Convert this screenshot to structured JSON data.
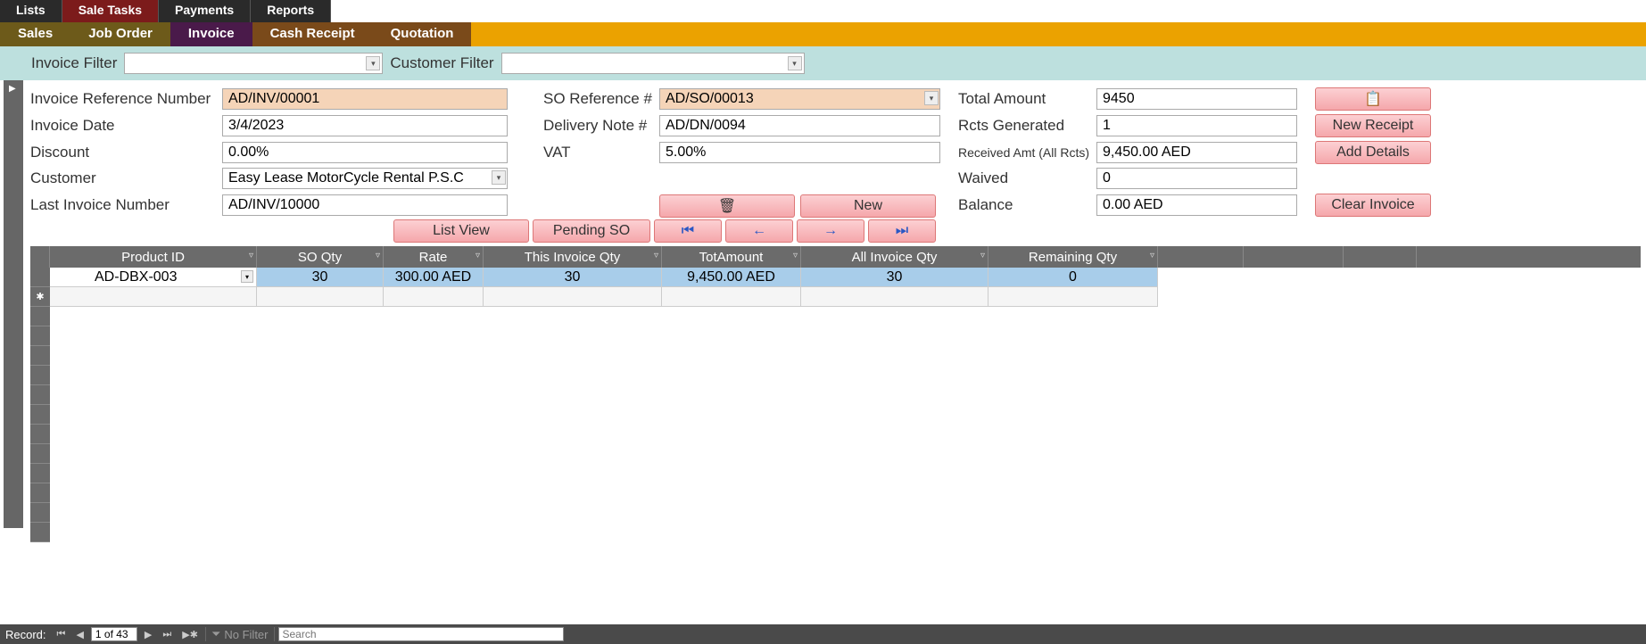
{
  "topTabs": {
    "lists": "Lists",
    "saleTasks": "Sale Tasks",
    "payments": "Payments",
    "reports": "Reports"
  },
  "subTabs": {
    "sales": "Sales",
    "jobOrder": "Job Order",
    "invoice": "Invoice",
    "cashReceipt": "Cash Receipt",
    "quotation": "Quotation"
  },
  "filters": {
    "invoiceFilterLabel": "Invoice Filter",
    "customerFilterLabel": "Customer Filter",
    "invoiceFilterValue": "",
    "customerFilterValue": ""
  },
  "form": {
    "invRefLbl": "Invoice Reference Number",
    "invRef": "AD/INV/00001",
    "invDateLbl": "Invoice Date",
    "invDate": "3/4/2023",
    "discountLbl": "Discount",
    "discount": "0.00%",
    "customerLbl": "Customer",
    "customer": "Easy Lease MotorCycle Rental P.S.C",
    "lastInvLbl": "Last Invoice Number",
    "lastInv": "AD/INV/10000",
    "soRefLbl": "SO Reference #",
    "soRef": "AD/SO/00013",
    "delNoteLbl": "Delivery Note #",
    "delNote": "AD/DN/0094",
    "vatLbl": "VAT",
    "vat": "5.00%",
    "totAmtLbl": "Total Amount",
    "totAmt": "9450",
    "rctsGenLbl": "Rcts Generated",
    "rctsGen": "1",
    "recvAmtLbl": "Received Amt (All Rcts)",
    "recvAmt": "9,450.00 AED",
    "waivedLbl": "Waived",
    "waived": "0",
    "balanceLbl": "Balance",
    "balance": "0.00 AED"
  },
  "buttons": {
    "copy": "📋",
    "newReceipt": "New Receipt",
    "addDetails": "Add Details",
    "clearInvoice": "Clear Invoice",
    "delete": "🗑",
    "new": "New",
    "listView": "List View",
    "pendingSO": "Pending SO",
    "first": "⏮",
    "prev": "←",
    "next": "→",
    "last": "⏭"
  },
  "gridHeaders": {
    "productId": "Product ID",
    "soQty": "SO Qty",
    "rate": "Rate",
    "thisInvQty": "This Invoice Qty",
    "totAmount": "TotAmount",
    "allInvQty": "All Invoice Qty",
    "remQty": "Remaining Qty"
  },
  "gridRows": [
    {
      "productId": "AD-DBX-003",
      "soQty": "30",
      "rate": "300.00 AED",
      "thisInvQty": "30",
      "totAmount": "9,450.00 AED",
      "allInvQty": "30",
      "remQty": "0"
    }
  ],
  "statusBar": {
    "recordLabel": "Record:",
    "position": "1 of 43",
    "noFilter": "No Filter",
    "searchPlaceholder": "Search"
  }
}
